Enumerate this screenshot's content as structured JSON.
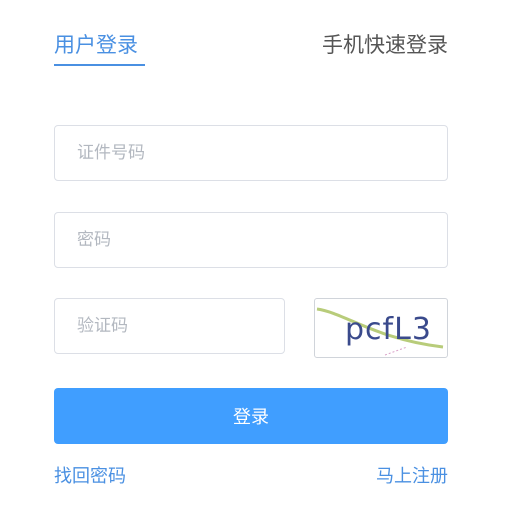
{
  "tabs": {
    "user_login": "用户登录",
    "mobile_login": "手机快速登录",
    "active": "user_login"
  },
  "form": {
    "id_placeholder": "证件号码",
    "password_placeholder": "密码",
    "captcha_placeholder": "验证码",
    "captcha_text": "pcfL3",
    "login_label": "登录"
  },
  "links": {
    "forgot_password": "找回密码",
    "register": "马上注册"
  },
  "colors": {
    "accent": "#4a90e2",
    "button": "#409eff",
    "border": "#dcdfe6"
  }
}
